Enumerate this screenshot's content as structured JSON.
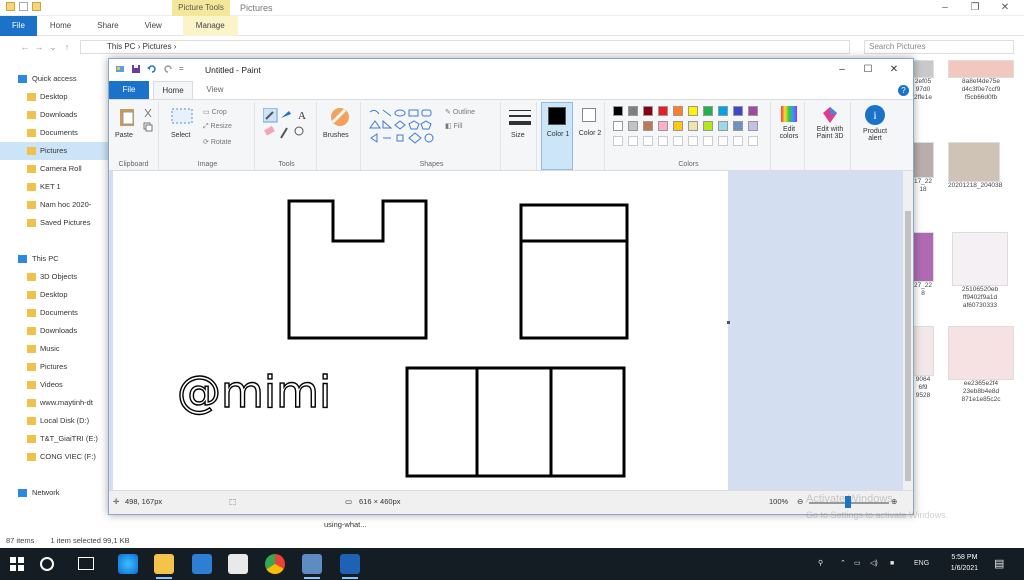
{
  "explorer": {
    "title": "Pictures",
    "contextual_tab": "Picture Tools",
    "tabs": [
      "File",
      "Home",
      "Share",
      "View",
      "Manage"
    ],
    "breadcrumb": [
      "This PC",
      "Pictures"
    ],
    "search_placeholder": "Search Pictures",
    "nav": [
      {
        "label": "Quick access",
        "root": true
      },
      {
        "label": "Desktop"
      },
      {
        "label": "Downloads"
      },
      {
        "label": "Documents"
      },
      {
        "label": "Pictures",
        "selected": true
      },
      {
        "label": "Camera Roll"
      },
      {
        "label": "KET 1"
      },
      {
        "label": "Nam hoc 2020-"
      },
      {
        "label": "Saved Pictures"
      },
      {
        "label": ""
      },
      {
        "label": "This PC",
        "root": true
      },
      {
        "label": "3D Objects"
      },
      {
        "label": "Desktop"
      },
      {
        "label": "Documents"
      },
      {
        "label": "Downloads"
      },
      {
        "label": "Music"
      },
      {
        "label": "Pictures"
      },
      {
        "label": "Videos"
      },
      {
        "label": "www.maytinh-dt"
      },
      {
        "label": "Local Disk (D:)"
      },
      {
        "label": "T&T_GiaiTRI (E:)"
      },
      {
        "label": "CONG VIEC (F:)"
      },
      {
        "label": ""
      },
      {
        "label": "Network",
        "root": true
      }
    ],
    "thumbs": [
      {
        "caption": "8a8ef4de75e d4c3f0e7ccf9 f5cb66d0fb"
      },
      {
        "caption": "20201218_204038"
      },
      {
        "caption": "25106520eb ff9402f9a1d af60730333"
      },
      {
        "caption": "ee2365e2f4 23eb8b4e8d 871e1e85c2c"
      }
    ],
    "partial_thumbs": [
      "2ef05 97d0 2ffe1e",
      "17_22 18",
      "27_22 8",
      "9064 6f9 9528"
    ],
    "status": {
      "items": "87 items",
      "selected": "1 item selected 99,1 KB"
    },
    "behind_text": "using-what..."
  },
  "paint": {
    "title": "Untitled - Paint",
    "tabs": {
      "file": "File",
      "home": "Home",
      "view": "View"
    },
    "clipboard": {
      "paste": "Paste",
      "label": "Clipboard"
    },
    "image": {
      "select": "Select",
      "crop": "Crop",
      "resize": "Resize",
      "rotate": "Rotate",
      "label": "Image"
    },
    "tools": {
      "label": "Tools"
    },
    "brushes": {
      "label": "Brushes"
    },
    "shapes": {
      "outline": "Outline",
      "fill": "Fill",
      "label": "Shapes"
    },
    "size": {
      "label": "Size"
    },
    "color1": {
      "label": "Color 1",
      "value": "#000000"
    },
    "color2": {
      "label": "Color 2",
      "value": "#ffffff"
    },
    "colors": {
      "label": "Colors"
    },
    "edit_colors": "Edit colors",
    "edit_3d": "Edit with Paint 3D",
    "product_alert": "Product alert",
    "palette": [
      "#000000",
      "#7f7f7f",
      "#880015",
      "#ed1c24",
      "#ff7f27",
      "#fff200",
      "#22b14c",
      "#00a2e8",
      "#3f48cc",
      "#a349a4",
      "#ffffff",
      "#c3c3c3",
      "#b97a57",
      "#ffaec9",
      "#ffc90e",
      "#efe4b0",
      "#b5e61d",
      "#99d9ea",
      "#7092be",
      "#c8bfe7"
    ],
    "canvas_text": "@mimi",
    "status": {
      "cursor": "498, 167px",
      "size": "616 × 460px",
      "zoom": "100%"
    }
  },
  "watermark": {
    "line1": "Activate Windows",
    "line2": "Go to Settings to activate Windows."
  },
  "taskbar": {
    "lang": "ENG",
    "time": "5:58 PM",
    "date": "1/6/2021"
  }
}
